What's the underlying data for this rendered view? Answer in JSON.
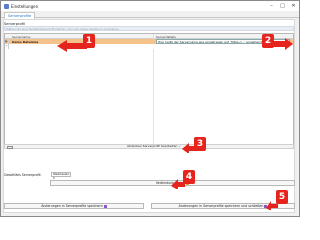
{
  "window": {
    "title": "Einstellungen"
  },
  "tabs": [
    {
      "label": "Serverprofile"
    }
  ],
  "server_profiles": {
    "group_label": "Serverprofil",
    "filter_hint": "Ziehen Sie eine Spaltenüberschrift hierher, um nach dieser Spalte zu gruppieren",
    "columns": [
      "Servername",
      "Serverdetails"
    ],
    "rows": [
      {
        "indicator": "▶",
        "name": "Demo Datumna",
        "description": "Hier heißt der Servername wie eingetragen auf 'https://...' eingehend"
      },
      {
        "indicator": "*",
        "name": "",
        "description": ""
      }
    ],
    "edit_button": "Abdecken Serverprofil bearbeiten"
  },
  "selected_profile": {
    "label": "Gewähltes Serverprofil:",
    "value": "Webdesiko-C"
  },
  "connection_test_button": "Verbindung testen",
  "actions": {
    "save": "Änderungen in Serverprofile speichern",
    "save_close": "Änderungen in Serverprofile speichern und schließen"
  },
  "callouts": [
    "1",
    "2",
    "3",
    "4",
    "5"
  ],
  "colors": {
    "callout": "#e5251d",
    "selected_row": "#f5c28b",
    "tab_text": "#2a6fc9"
  }
}
